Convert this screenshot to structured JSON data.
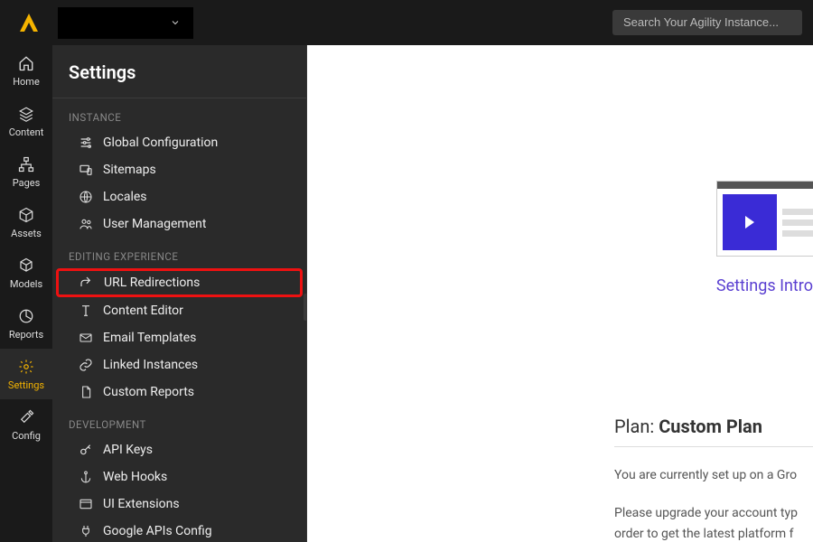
{
  "topbar": {
    "search_placeholder": "Search Your Agility Instance..."
  },
  "rail": [
    {
      "label": "Home"
    },
    {
      "label": "Content"
    },
    {
      "label": "Pages"
    },
    {
      "label": "Assets"
    },
    {
      "label": "Models"
    },
    {
      "label": "Reports"
    },
    {
      "label": "Settings"
    },
    {
      "label": "Config"
    }
  ],
  "settings": {
    "title": "Settings",
    "sections": {
      "instance": {
        "label": "INSTANCE"
      },
      "editing": {
        "label": "EDITING EXPERIENCE"
      },
      "development": {
        "label": "DEVELOPMENT"
      }
    },
    "items": {
      "global_config": "Global Configuration",
      "sitemaps": "Sitemaps",
      "locales": "Locales",
      "user_mgmt": "User Management",
      "url_redirects": "URL Redirections",
      "content_editor": "Content Editor",
      "email_templates": "Email Templates",
      "linked_instances": "Linked Instances",
      "custom_reports": "Custom Reports",
      "api_keys": "API Keys",
      "web_hooks": "Web Hooks",
      "ui_extensions": "UI Extensions",
      "google_apis": "Google APIs Config"
    }
  },
  "content": {
    "video_link": "Settings Intro Vide",
    "plan_prefix": "Plan: ",
    "plan_name": "Custom Plan",
    "plan_line1": "You are currently set up on a Gro",
    "plan_line2": "Please upgrade your account typ",
    "plan_line3": "order to get the latest platform f"
  }
}
